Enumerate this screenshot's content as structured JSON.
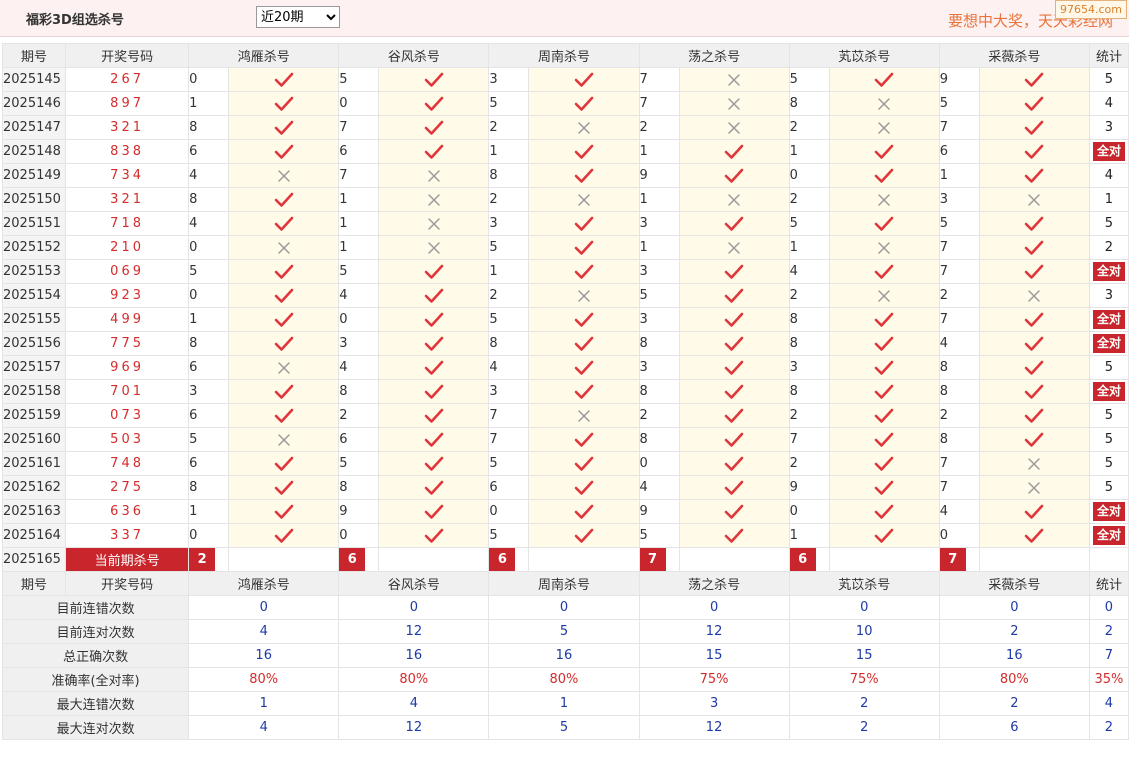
{
  "header": {
    "title": "福彩3D组选杀号",
    "select_value": "近20期",
    "select_options": [
      "近20期"
    ],
    "slogan": "要想中大奖，天天彩经网",
    "watermark": "97654.com"
  },
  "columns": {
    "period": "期号",
    "numbers": "开奖号码",
    "experts": [
      "鸿雁杀号",
      "谷风杀号",
      "周南杀号",
      "荡之杀号",
      "芄苡杀号",
      "采薇杀号"
    ],
    "stat": "统计"
  },
  "all_correct_label": "全对",
  "rows": [
    {
      "period": "2025145",
      "nums": "267",
      "kills": [
        [
          "0",
          1
        ],
        [
          "5",
          1
        ],
        [
          "3",
          1
        ],
        [
          "7",
          0
        ],
        [
          "5",
          1
        ],
        [
          "9",
          1
        ]
      ],
      "stat": "5"
    },
    {
      "period": "2025146",
      "nums": "897",
      "kills": [
        [
          "1",
          1
        ],
        [
          "0",
          1
        ],
        [
          "5",
          1
        ],
        [
          "7",
          0
        ],
        [
          "8",
          0
        ],
        [
          "5",
          1
        ]
      ],
      "stat": "4"
    },
    {
      "period": "2025147",
      "nums": "321",
      "kills": [
        [
          "8",
          1
        ],
        [
          "7",
          1
        ],
        [
          "2",
          0
        ],
        [
          "2",
          0
        ],
        [
          "2",
          0
        ],
        [
          "7",
          1
        ]
      ],
      "stat": "3"
    },
    {
      "period": "2025148",
      "nums": "838",
      "kills": [
        [
          "6",
          1
        ],
        [
          "6",
          1
        ],
        [
          "1",
          1
        ],
        [
          "1",
          1
        ],
        [
          "1",
          1
        ],
        [
          "6",
          1
        ]
      ],
      "stat": "全对"
    },
    {
      "period": "2025149",
      "nums": "734",
      "kills": [
        [
          "4",
          0
        ],
        [
          "7",
          0
        ],
        [
          "8",
          1
        ],
        [
          "9",
          1
        ],
        [
          "0",
          1
        ],
        [
          "1",
          1
        ]
      ],
      "stat": "4"
    },
    {
      "period": "2025150",
      "nums": "321",
      "kills": [
        [
          "8",
          1
        ],
        [
          "1",
          0
        ],
        [
          "2",
          0
        ],
        [
          "1",
          0
        ],
        [
          "2",
          0
        ],
        [
          "3",
          0
        ]
      ],
      "stat": "1"
    },
    {
      "period": "2025151",
      "nums": "718",
      "kills": [
        [
          "4",
          1
        ],
        [
          "1",
          0
        ],
        [
          "3",
          1
        ],
        [
          "3",
          1
        ],
        [
          "5",
          1
        ],
        [
          "5",
          1
        ]
      ],
      "stat": "5"
    },
    {
      "period": "2025152",
      "nums": "210",
      "kills": [
        [
          "0",
          0
        ],
        [
          "1",
          0
        ],
        [
          "5",
          1
        ],
        [
          "1",
          0
        ],
        [
          "1",
          0
        ],
        [
          "7",
          1
        ]
      ],
      "stat": "2"
    },
    {
      "period": "2025153",
      "nums": "069",
      "kills": [
        [
          "5",
          1
        ],
        [
          "5",
          1
        ],
        [
          "1",
          1
        ],
        [
          "3",
          1
        ],
        [
          "4",
          1
        ],
        [
          "7",
          1
        ]
      ],
      "stat": "全对"
    },
    {
      "period": "2025154",
      "nums": "923",
      "kills": [
        [
          "0",
          1
        ],
        [
          "4",
          1
        ],
        [
          "2",
          0
        ],
        [
          "5",
          1
        ],
        [
          "2",
          0
        ],
        [
          "2",
          0
        ]
      ],
      "stat": "3"
    },
    {
      "period": "2025155",
      "nums": "499",
      "kills": [
        [
          "1",
          1
        ],
        [
          "0",
          1
        ],
        [
          "5",
          1
        ],
        [
          "3",
          1
        ],
        [
          "8",
          1
        ],
        [
          "7",
          1
        ]
      ],
      "stat": "全对"
    },
    {
      "period": "2025156",
      "nums": "775",
      "kills": [
        [
          "8",
          1
        ],
        [
          "3",
          1
        ],
        [
          "8",
          1
        ],
        [
          "8",
          1
        ],
        [
          "8",
          1
        ],
        [
          "4",
          1
        ]
      ],
      "stat": "全对"
    },
    {
      "period": "2025157",
      "nums": "969",
      "kills": [
        [
          "6",
          0
        ],
        [
          "4",
          1
        ],
        [
          "4",
          1
        ],
        [
          "3",
          1
        ],
        [
          "3",
          1
        ],
        [
          "8",
          1
        ]
      ],
      "stat": "5"
    },
    {
      "period": "2025158",
      "nums": "701",
      "kills": [
        [
          "3",
          1
        ],
        [
          "8",
          1
        ],
        [
          "3",
          1
        ],
        [
          "8",
          1
        ],
        [
          "8",
          1
        ],
        [
          "8",
          1
        ]
      ],
      "stat": "全对"
    },
    {
      "period": "2025159",
      "nums": "073",
      "kills": [
        [
          "6",
          1
        ],
        [
          "2",
          1
        ],
        [
          "7",
          0
        ],
        [
          "2",
          1
        ],
        [
          "2",
          1
        ],
        [
          "2",
          1
        ]
      ],
      "stat": "5"
    },
    {
      "period": "2025160",
      "nums": "503",
      "kills": [
        [
          "5",
          0
        ],
        [
          "6",
          1
        ],
        [
          "7",
          1
        ],
        [
          "8",
          1
        ],
        [
          "7",
          1
        ],
        [
          "8",
          1
        ]
      ],
      "stat": "5"
    },
    {
      "period": "2025161",
      "nums": "748",
      "kills": [
        [
          "6",
          1
        ],
        [
          "5",
          1
        ],
        [
          "5",
          1
        ],
        [
          "0",
          1
        ],
        [
          "2",
          1
        ],
        [
          "7",
          0
        ]
      ],
      "stat": "5"
    },
    {
      "period": "2025162",
      "nums": "275",
      "kills": [
        [
          "8",
          1
        ],
        [
          "8",
          1
        ],
        [
          "6",
          1
        ],
        [
          "4",
          1
        ],
        [
          "9",
          1
        ],
        [
          "7",
          0
        ]
      ],
      "stat": "5"
    },
    {
      "period": "2025163",
      "nums": "636",
      "kills": [
        [
          "1",
          1
        ],
        [
          "9",
          1
        ],
        [
          "0",
          1
        ],
        [
          "9",
          1
        ],
        [
          "0",
          1
        ],
        [
          "4",
          1
        ]
      ],
      "stat": "全对"
    },
    {
      "period": "2025164",
      "nums": "337",
      "kills": [
        [
          "0",
          1
        ],
        [
          "0",
          1
        ],
        [
          "5",
          1
        ],
        [
          "5",
          1
        ],
        [
          "1",
          1
        ],
        [
          "0",
          1
        ]
      ],
      "stat": "全对"
    }
  ],
  "current": {
    "period": "2025165",
    "label": "当前期杀号",
    "kills": [
      "2",
      "6",
      "6",
      "7",
      "6",
      "7"
    ]
  },
  "summary": [
    {
      "label": "目前连错次数",
      "values": [
        "0",
        "0",
        "0",
        "0",
        "0",
        "0"
      ],
      "stat": "0",
      "red": false
    },
    {
      "label": "目前连对次数",
      "values": [
        "4",
        "12",
        "5",
        "12",
        "10",
        "2"
      ],
      "stat": "2",
      "red": false
    },
    {
      "label": "总正确次数",
      "values": [
        "16",
        "16",
        "16",
        "15",
        "15",
        "16"
      ],
      "stat": "7",
      "red": false
    },
    {
      "label": "准确率(全对率)",
      "values": [
        "80%",
        "80%",
        "80%",
        "75%",
        "75%",
        "80%"
      ],
      "stat": "35%",
      "red": true
    },
    {
      "label": "最大连错次数",
      "values": [
        "1",
        "4",
        "1",
        "3",
        "2",
        "2"
      ],
      "stat": "4",
      "red": false
    },
    {
      "label": "最大连对次数",
      "values": [
        "4",
        "12",
        "5",
        "12",
        "2",
        "6"
      ],
      "stat": "2",
      "red": false
    }
  ],
  "colors": {
    "accent": "#c8262c",
    "check": "#e0353b",
    "cross": "#9a9a9a",
    "summary_blue": "#1d3aa6"
  }
}
